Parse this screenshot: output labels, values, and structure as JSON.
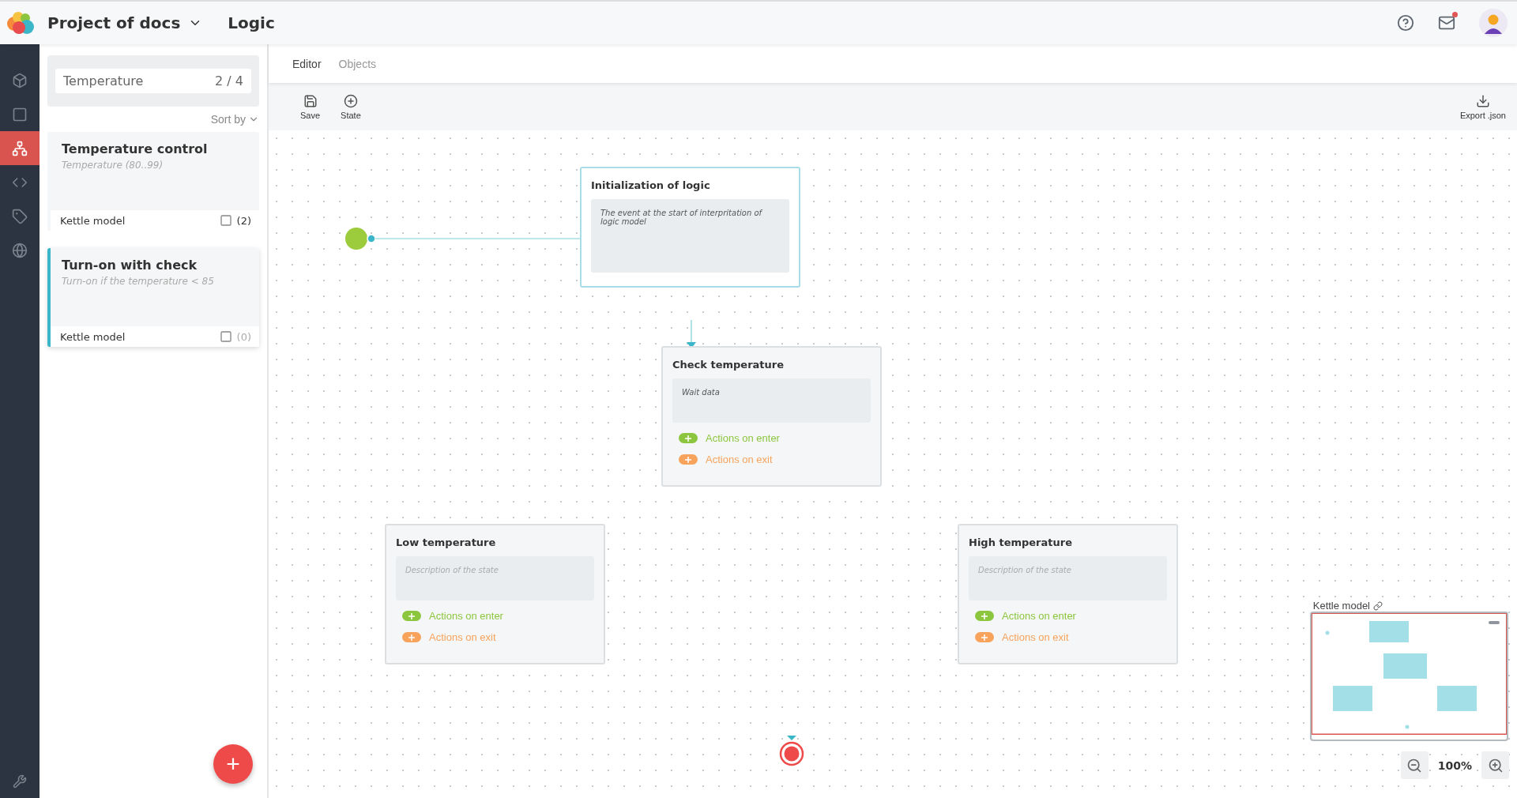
{
  "header": {
    "project": "Project of docs",
    "page": "Logic",
    "mail_unread": true
  },
  "rail": {
    "items": [
      {
        "kind": "cube",
        "selected": false
      },
      {
        "kind": "frame",
        "selected": false
      },
      {
        "kind": "hierarchy",
        "selected": true
      },
      {
        "kind": "code",
        "selected": false
      },
      {
        "kind": "tag",
        "selected": false
      },
      {
        "kind": "globe",
        "selected": false
      }
    ]
  },
  "search": {
    "value": "Temperature",
    "count": "2 / 4"
  },
  "sort": {
    "label": "Sort by"
  },
  "cards": [
    {
      "title": "Temperature control",
      "subtitle": "Temperature (80..99)",
      "model": "Kettle model",
      "count": "(2)",
      "empty": false,
      "selected": false
    },
    {
      "title": "Turn-on with check",
      "subtitle": "Turn-on if the temperature < 85",
      "model": "Kettle model",
      "count": "(0)",
      "empty": true,
      "selected": true
    }
  ],
  "add_button": {
    "label": "+"
  },
  "tabs": [
    {
      "label": "Editor",
      "selected": true
    },
    {
      "label": "Objects",
      "selected": false
    }
  ],
  "toolbar": [
    {
      "kind": "save",
      "label": "Save"
    },
    {
      "kind": "state",
      "label": "State"
    }
  ],
  "export": {
    "label": "Export .json"
  },
  "nodes": [
    {
      "kind": "event",
      "title": "Initialization of logic",
      "description": "The event at the start of interpritation of logic model",
      "selected": true
    },
    {
      "kind": "state",
      "title": "Check temperature",
      "description": "Wait data",
      "selected": false,
      "actions": [
        {
          "kind": "enter",
          "label": "Actions on enter"
        },
        {
          "kind": "exit",
          "label": "Actions on exit"
        }
      ]
    },
    {
      "kind": "state",
      "title": "Low temperature",
      "placeholder": "Description of the state",
      "selected": false,
      "actions": [
        {
          "kind": "enter",
          "label": "Actions on enter"
        },
        {
          "kind": "exit",
          "label": "Actions on exit"
        }
      ]
    },
    {
      "kind": "state",
      "title": "High temperature",
      "placeholder": "Description of the state",
      "selected": false,
      "actions": [
        {
          "kind": "enter",
          "label": "Actions on enter"
        },
        {
          "kind": "exit",
          "label": "Actions on exit"
        }
      ]
    }
  ],
  "minimap": {
    "title": "Kettle model"
  },
  "zoom": {
    "value": "100%"
  }
}
